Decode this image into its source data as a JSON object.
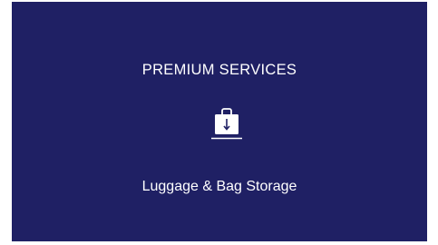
{
  "card": {
    "heading": "PREMIUM SERVICES",
    "service_icon": "luggage-storage-icon",
    "service_label": "Luggage & Bag Storage"
  },
  "colors": {
    "card_background": "#1f2064",
    "text": "#ffffff"
  }
}
